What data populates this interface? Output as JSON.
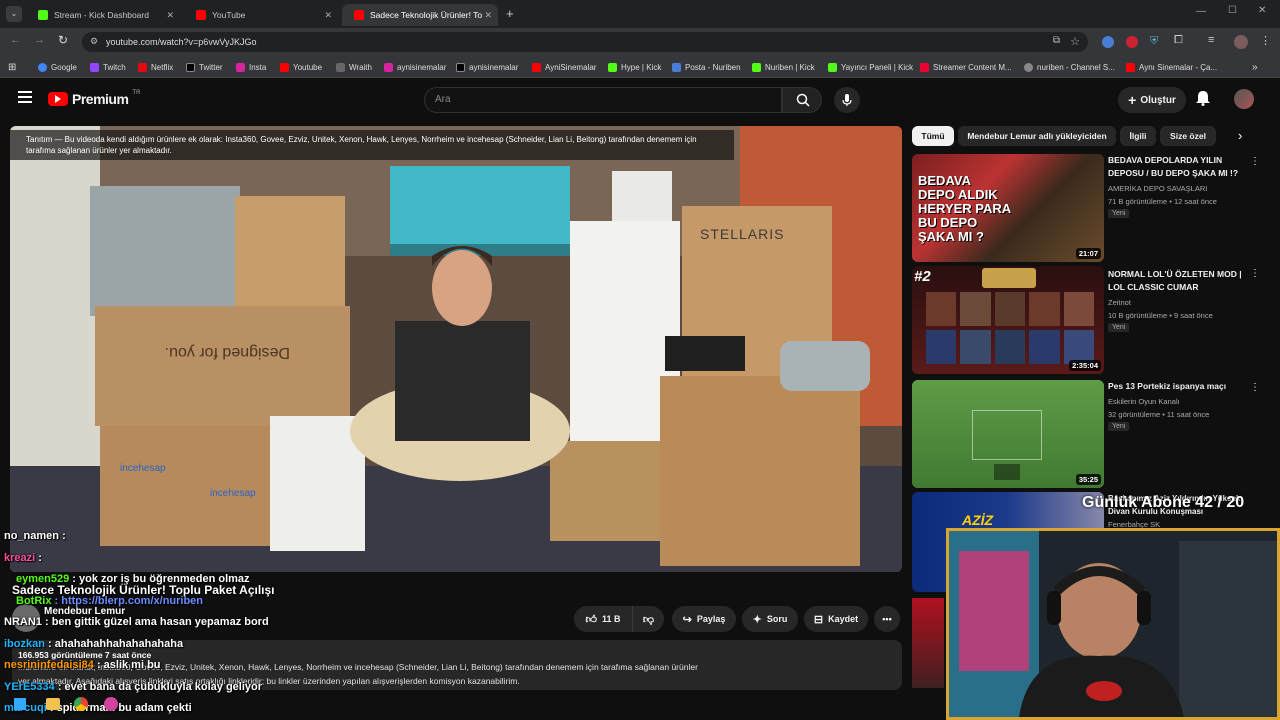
{
  "browser": {
    "tabs": [
      {
        "title": "Stream - Kick Dashboard",
        "color": "#53fc18"
      },
      {
        "title": "YouTube",
        "color": "#ff0000"
      },
      {
        "title": "Sadece Teknolojik Ürünler! Topl",
        "color": "#ff0000"
      }
    ],
    "url": "youtube.com/watch?v=p6vwVyJKJGo",
    "bookmarks": [
      "Google",
      "Twitch",
      "Netflix",
      "Twitter",
      "Insta",
      "Youtube",
      "Wraith",
      "aynisinemalar",
      "aynisinemalar",
      "AyniSinemalar",
      "Hype | Kick",
      "Posta - Nuriben",
      "Nuriben | Kick",
      "Yayıncı Paneli | Kick",
      "Streamer Content M...",
      "nuriben - Channel S...",
      "Aynı Sinemalar - Ça..."
    ]
  },
  "youtube": {
    "logo_text": "Premium",
    "logo_region": "TR",
    "search_placeholder": "Ara",
    "create_label": "Oluştur"
  },
  "video": {
    "description_overlay": "Tanıtım — Bu videoda kendi aldığım ürünlere ek olarak: Insta360, Govee, Ezviz, Unitek, Xenon, Hawk, Lenyes, Norrheim ve incehesap (Schneider, Lian Li, Beitong) tarafından denemem için tarafıma sağlanan ürünler yer almaktadır.",
    "title": "Sadece Teknolojik Ürünler! Toplu Paket Açılışı",
    "channel": "Mendebur Lemur",
    "like_count": "11 B",
    "actions": [
      "Paylaş",
      "Soru",
      "Kaydet"
    ],
    "views_line": "166.953 görüntüleme  7 saat önce",
    "description_line1": "...ürünlere ek olarak; Insta360, Govee, Ezviz, Unitek, Xenon, Hawk, Lenyes, Norrheim ve incehesap (Schneider, Lian Li, Beitong) tarafından denemem için tarafıma sağlanan ürünler",
    "description_line2": "yer almaktadır. Aşağıdaki alışveriş linkleri satış ortaklığı linkleridir; bu linkler üzerinden yapılan alışverişlerden komisyon kazanabilirim."
  },
  "chips": [
    "Tümü",
    "Mendebur Lemur adlı yükleyiciden",
    "İlgili",
    "Size özel"
  ],
  "recommendations": [
    {
      "title": "BEDAVA DEPOLARDA YILIN DEPOSU / BU DEPO ŞAKA MI !?",
      "channel": "AMERİKA DEPO SAVAŞLARI",
      "meta": "71 B görüntüleme • 12 saat önce",
      "badge": "Yeni",
      "duration": "21:07",
      "color": "#3a2a1c"
    },
    {
      "title": "NORMAL LOL'Ü ÖZLETEN MOD | LOL CLASSIC CUMAR",
      "channel": "Zeitnot",
      "meta": "10 B görüntüleme • 9 saat önce",
      "badge": "Yeni",
      "duration": "2:35:04",
      "color": "#3d1414"
    },
    {
      "title": "Pes 13 Portekiz ispanya maçı",
      "channel": "Eskilerin Oyun Kanalı",
      "meta": "32 görüntüleme • 11 saat önce",
      "badge": "Yeni",
      "duration": "35:25",
      "color": "#4f8f3c"
    },
    {
      "title": "Başkanımız Aziz Yıldırım'ın Yüksek Divan Kurulu Konuşması",
      "channel": "Fenerbahçe SK",
      "meta": "",
      "badge": "",
      "duration": "",
      "color": "#0d1e4a"
    }
  ],
  "chat": [
    {
      "user": "no_namen",
      "text": ":",
      "color": "#ffffff"
    },
    {
      "user": "kreazi",
      "text": ":",
      "color": "#ff4f9a"
    },
    {
      "user": "eymen529",
      "text": ": yok zor iş bu öğrenmeden olmaz",
      "color": "#53fc18"
    },
    {
      "user": "BotRix",
      "text": ": https://blerp.com/x/nuriben",
      "color": "#53fc18"
    },
    {
      "user": "NRAN1",
      "text": ": ben gittik güzel ama hasan yepamaz bord",
      "color": "#ffffff"
    },
    {
      "user": "ibozkan",
      "text": ": ahahahahhahahahahaha",
      "color": "#1fb6ff"
    },
    {
      "user": "nesrininfedaisi84",
      "text": ": aslik mi bu",
      "color": "#ff9900"
    },
    {
      "user": "YErE5334",
      "text": ": evet bana da çubukluyla kolay geliyor",
      "color": "#1fb6ff"
    },
    {
      "user": "marcuqi",
      "text": ": spidermanı bu adam çekti",
      "color": "#1fb6ff"
    }
  ],
  "overlay": {
    "subs_goal": "Günlük Abone 42 / 20"
  }
}
